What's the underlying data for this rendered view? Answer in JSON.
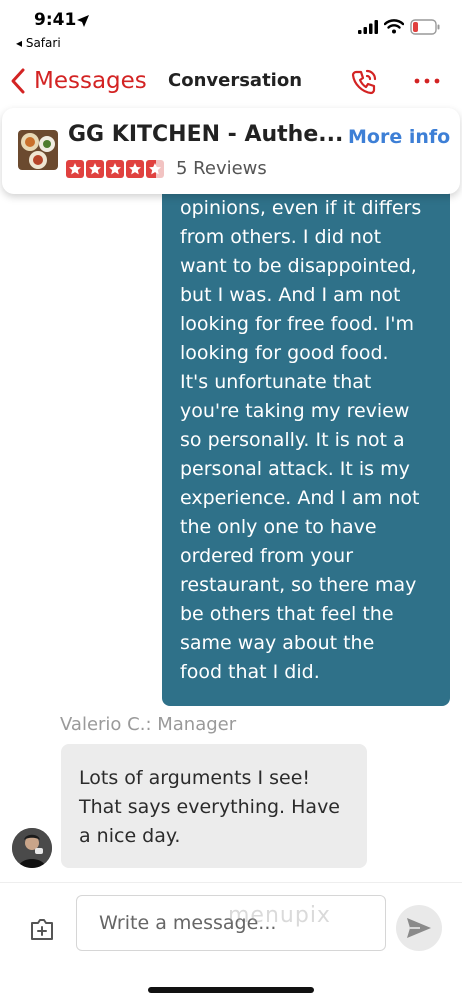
{
  "status_bar": {
    "time": "9:41",
    "back_app": "◂ Safari",
    "icons": [
      "location-arrow-icon",
      "signal-icon",
      "wifi-icon",
      "battery-low-icon"
    ],
    "battery_color": "#e0413f"
  },
  "nav": {
    "back_label": "Messages",
    "title": "Conversation",
    "accent_color": "#d32323",
    "icons": [
      "chevron-left-icon",
      "phone-icon",
      "more-icon"
    ]
  },
  "business": {
    "name": "GG KITCHEN - Authe...",
    "more_info_label": "More info",
    "rating": 4.5,
    "rating_max": 5,
    "reviews_text": "5 Reviews"
  },
  "messages": {
    "outgoing_text": "opinions, even if it differs\nfrom others. I did not\nwant to be disappointed,\nbut I was. And I am not\nlooking for free food. I'm\nlooking for good food.\nIt's unfortunate that\nyou're taking my review\nso personally. It is not a\npersonal attack. It is my\nexperience. And I am not\nthe only one to have\nordered from your\nrestaurant, so there may\nbe others that feel the\nsame way about the\nfood that I did.",
    "outgoing_color": "#2f7189",
    "sender_label": "Valerio C.: Manager",
    "incoming_text": "Lots of arguments I see!\nThat says everything. Have\na nice day."
  },
  "composer": {
    "placeholder": "Write a message...",
    "watermark": "menupix",
    "icons": [
      "add-attachment-icon",
      "send-icon"
    ]
  }
}
